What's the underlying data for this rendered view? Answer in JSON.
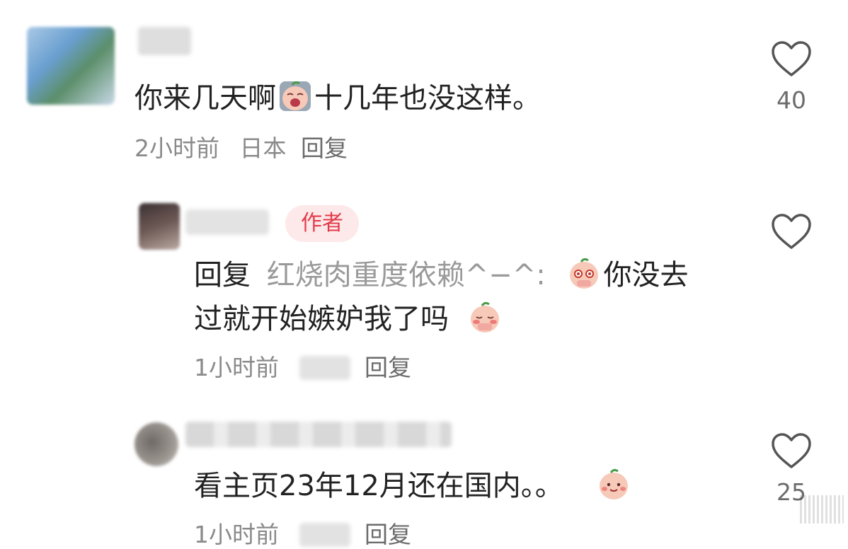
{
  "comments": [
    {
      "text_before": "你来几天啊",
      "emoji": "crying-face-emoji",
      "text_after": "十几年也没这样。",
      "time": "2小时前",
      "location": "日本",
      "reply_label": "回复",
      "likes": "40"
    },
    {
      "badge": "作者",
      "reply_prefix": "回复",
      "mention": "红烧肉重度依赖^−^:",
      "text_line1": "你没去",
      "text_line2": "过就开始嫉妒我了吗",
      "time": "1小时前",
      "reply_label": "回复"
    },
    {
      "text": "看主页23年12月还在国内。。",
      "time": "1小时前",
      "reply_label": "回复",
      "likes": "25"
    }
  ],
  "colors": {
    "badge_bg": "#fde9ea",
    "badge_text": "#e23b4a",
    "meta": "#8a8a8a",
    "text": "#222222"
  }
}
